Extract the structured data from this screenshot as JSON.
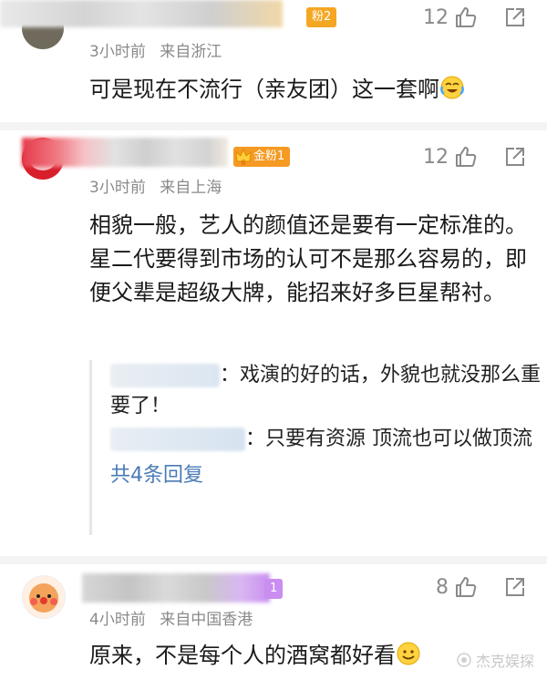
{
  "comments": [
    {
      "badge": "粉2",
      "badge_color": "#f5a623",
      "likes": "12",
      "time": "3小时前",
      "location": "来自浙江",
      "text": "可是现在不流行（亲友团）这一套啊"
    },
    {
      "badge": "金粉1",
      "badge_color": "#f59a23",
      "badge_level": "6",
      "likes": "12",
      "time": "3小时前",
      "location": "来自上海",
      "text": "相貌一般，艺人的颜值还是要有一定标准的。星二代要得到市场的认可不是那么容易的，即便父辈是超级大牌，能招来好多巨星帮衬。",
      "replies": [
        {
          "text": "：戏演的好的话，外貌也就没那么重要了！"
        },
        {
          "text": "：只要有资源 顶流也可以做顶流"
        }
      ],
      "more_replies": "共4条回复"
    },
    {
      "badge": "1",
      "badge_color": "#c98ef0",
      "likes": "8",
      "time": "4小时前",
      "location": "来自中国香港",
      "text": "原来，不是每个人的酒窝都好看"
    }
  ],
  "watermark": "杰克娱探",
  "colors": {
    "meta": "#8a8a8a",
    "link": "#4a7bb6",
    "divider": "#f4f4f4"
  },
  "icons": [
    "like-icon",
    "share-icon",
    "laugh-cry-emoji",
    "smile-emoji"
  ]
}
